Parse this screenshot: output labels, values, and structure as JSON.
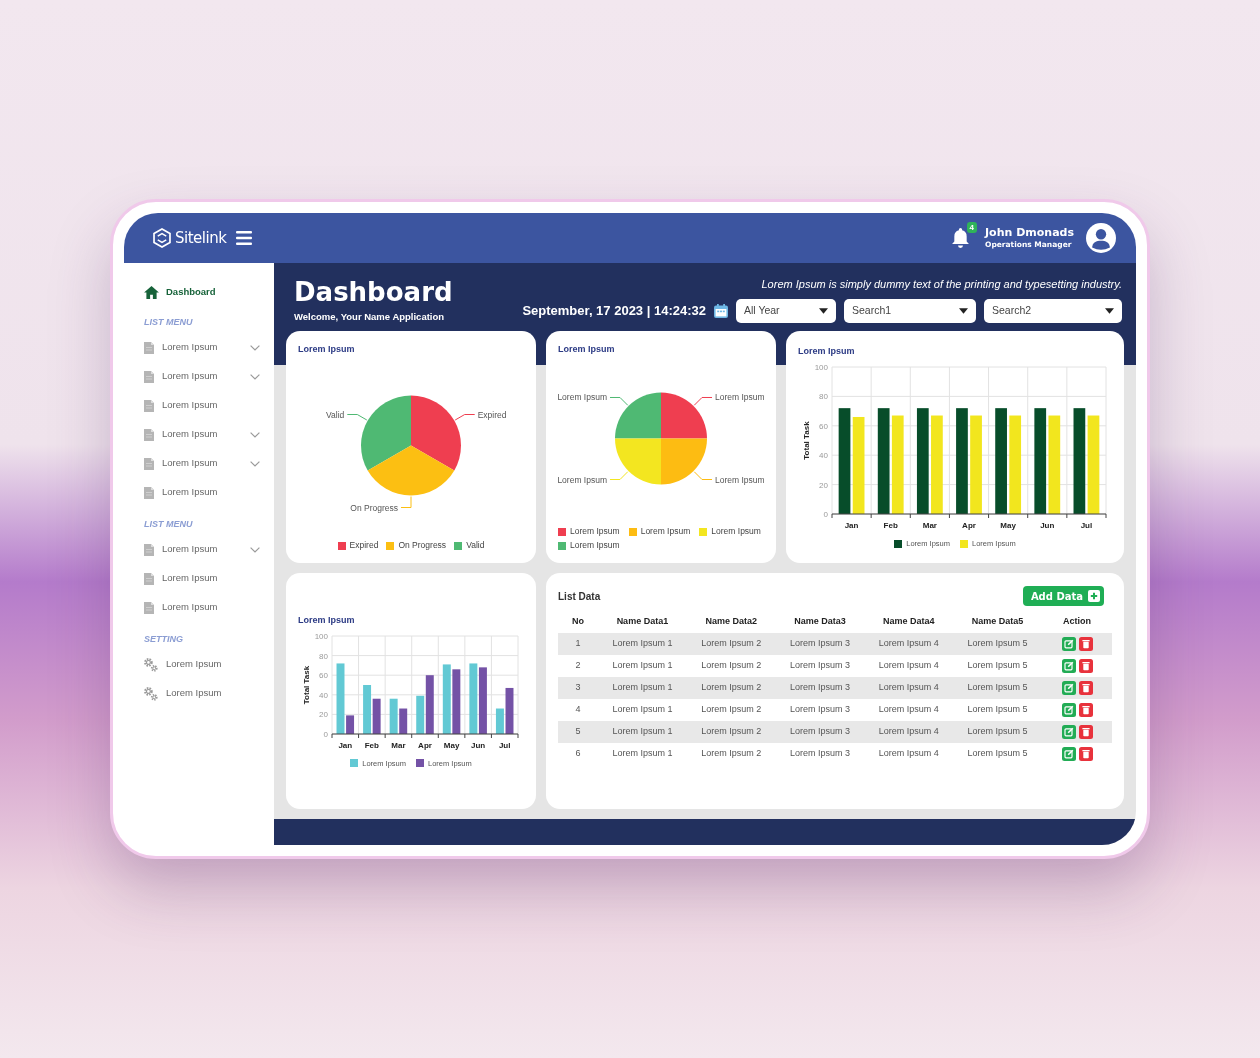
{
  "top_bar": {
    "logo": "Sitelink",
    "notification_count": "4",
    "user": {
      "name": "John Dmonads",
      "role": "Operations Manager"
    }
  },
  "sidebar": {
    "dashboard": {
      "label": "Dashboard",
      "selected": true
    },
    "sections": [
      {
        "title": "LIST MENU",
        "items": [
          {
            "label": "Lorem Ipsum",
            "kind": "page",
            "expandable": true,
            "selected": false
          },
          {
            "label": "Lorem Ipsum",
            "kind": "page",
            "expandable": true,
            "selected": false
          },
          {
            "label": "Lorem Ipsum",
            "kind": "page",
            "expandable": false,
            "selected": false
          },
          {
            "label": "Lorem Ipsum",
            "kind": "page",
            "expandable": true,
            "selected": false
          },
          {
            "label": "Lorem Ipsum",
            "kind": "page",
            "expandable": true,
            "selected": false
          },
          {
            "label": "Lorem Ipsum",
            "kind": "page",
            "expandable": false,
            "selected": false
          }
        ]
      },
      {
        "title": "LIST MENU",
        "items": [
          {
            "label": "Lorem Ipsum",
            "kind": "page",
            "expandable": true,
            "selected": false
          },
          {
            "label": "Lorem Ipsum",
            "kind": "page",
            "expandable": false,
            "selected": false
          },
          {
            "label": "Lorem Ipsum",
            "kind": "page",
            "expandable": false,
            "selected": false
          }
        ]
      },
      {
        "title": "SETTING",
        "items": [
          {
            "label": "Lorem Ipsum",
            "kind": "gear",
            "expandable": false,
            "selected": false
          },
          {
            "label": "Lorem Ipsum",
            "kind": "gear",
            "expandable": false,
            "selected": false
          }
        ]
      }
    ]
  },
  "header": {
    "title": "Dashboard",
    "subtitle": "Welcome, Your Name Application",
    "tagline": "Lorem Ipsum is simply dummy text of the printing and typesetting industry.",
    "datetime": "September, 17 2023 | 14:24:32",
    "filters": [
      {
        "value": "All Year"
      },
      {
        "value": "Search1"
      },
      {
        "value": "Search2"
      }
    ]
  },
  "cards": [
    {
      "kind": "pie",
      "title": "Lorem Ipsum",
      "slices": [
        {
          "label": "Valid",
          "color": "#4fb973"
        },
        {
          "label": "Expired",
          "color": "#ef3e50"
        },
        {
          "label": "On Progress",
          "color": "#fcbf12"
        }
      ],
      "legend": [
        {
          "label": "Expired",
          "color": "#ef3e50"
        },
        {
          "label": "On Progress",
          "color": "#fcbf12"
        },
        {
          "label": "Valid",
          "color": "#4fb973"
        }
      ]
    },
    {
      "kind": "pie",
      "title": "Lorem Ipsum",
      "slices": [
        {
          "label": "Lorem Ipsum",
          "color": "#4fb973"
        },
        {
          "label": "Lorem Ipsum",
          "color": "#ef3e50"
        },
        {
          "label": "Lorem Ipsum",
          "color": "#f3e620"
        },
        {
          "label": "Lorem Ipsum",
          "color": "#fdbc12"
        }
      ],
      "legend": [
        {
          "label": "Lorem Ipsum",
          "color": "#ef3e50"
        },
        {
          "label": "Lorem Ipsum",
          "color": "#fdbc12"
        },
        {
          "label": "Lorem Ipsum",
          "color": "#f3e620"
        },
        {
          "label": "Lorem Ipsum",
          "color": "#4fb973"
        }
      ]
    },
    {
      "kind": "bar",
      "chart_data": {
        "type": "bar",
        "title": "Lorem Ipsum",
        "ylabel": "Total Task",
        "categories": [
          "Jan",
          "Feb",
          "Mar",
          "Apr",
          "May",
          "Jun",
          "Jul"
        ],
        "series": [
          {
            "name": "Lorem Ipsum",
            "color": "#074d2a",
            "values": [
              72,
              72,
              72,
              72,
              72,
              72,
              72
            ]
          },
          {
            "name": "Lorem Ipsum",
            "color": "#f2e61e",
            "values": [
              66,
              67,
              67,
              67,
              67,
              67,
              67
            ]
          }
        ],
        "ylim": [
          0,
          100
        ],
        "yticks": [
          0,
          20,
          40,
          60,
          80,
          100
        ],
        "grid": true
      }
    },
    {
      "kind": "bar",
      "chart_data": {
        "type": "bar",
        "title": "Lorem Ipsum",
        "ylabel": "Total Task",
        "categories": [
          "Jan",
          "Feb",
          "Mar",
          "Apr",
          "May",
          "Jun",
          "Jul"
        ],
        "series": [
          {
            "name": "Lorem Ipsum",
            "color": "#62c9d4",
            "values": [
              72,
              50,
              36,
              39,
              71,
              72,
              26
            ]
          },
          {
            "name": "Lorem Ipsum",
            "color": "#7452a6",
            "values": [
              19,
              36,
              26,
              60,
              66,
              68,
              47
            ]
          }
        ],
        "ylim": [
          0,
          100
        ],
        "yticks": [
          0,
          20,
          40,
          60,
          80,
          100
        ],
        "grid": true
      }
    },
    {
      "kind": "table",
      "title": "List Data",
      "button": "Add Data",
      "columns": [
        "No",
        "Name Data1",
        "Name Data2",
        "Name Data3",
        "Name Data4",
        "Name Data5",
        "Action"
      ],
      "rows": [
        {
          "cells": [
            "1",
            "Lorem Ipsum 1",
            "Lorem Ipsum 2",
            "Lorem Ipsum 3",
            "Lorem Ipsum 4",
            "Lorem Ipsum 5"
          ]
        },
        {
          "cells": [
            "2",
            "Lorem Ipsum 1",
            "Lorem Ipsum 2",
            "Lorem Ipsum 3",
            "Lorem Ipsum 4",
            "Lorem Ipsum 5"
          ]
        },
        {
          "cells": [
            "3",
            "Lorem Ipsum 1",
            "Lorem Ipsum 2",
            "Lorem Ipsum 3",
            "Lorem Ipsum 4",
            "Lorem Ipsum 5"
          ]
        },
        {
          "cells": [
            "4",
            "Lorem Ipsum 1",
            "Lorem Ipsum 2",
            "Lorem Ipsum 3",
            "Lorem Ipsum 4",
            "Lorem Ipsum 5"
          ]
        },
        {
          "cells": [
            "5",
            "Lorem Ipsum 1",
            "Lorem Ipsum 2",
            "Lorem Ipsum 3",
            "Lorem Ipsum 4",
            "Lorem Ipsum 5"
          ]
        },
        {
          "cells": [
            "6",
            "Lorem Ipsum 1",
            "Lorem Ipsum 2",
            "Lorem Ipsum 3",
            "Lorem Ipsum 4",
            "Lorem Ipsum 5"
          ]
        }
      ]
    }
  ]
}
